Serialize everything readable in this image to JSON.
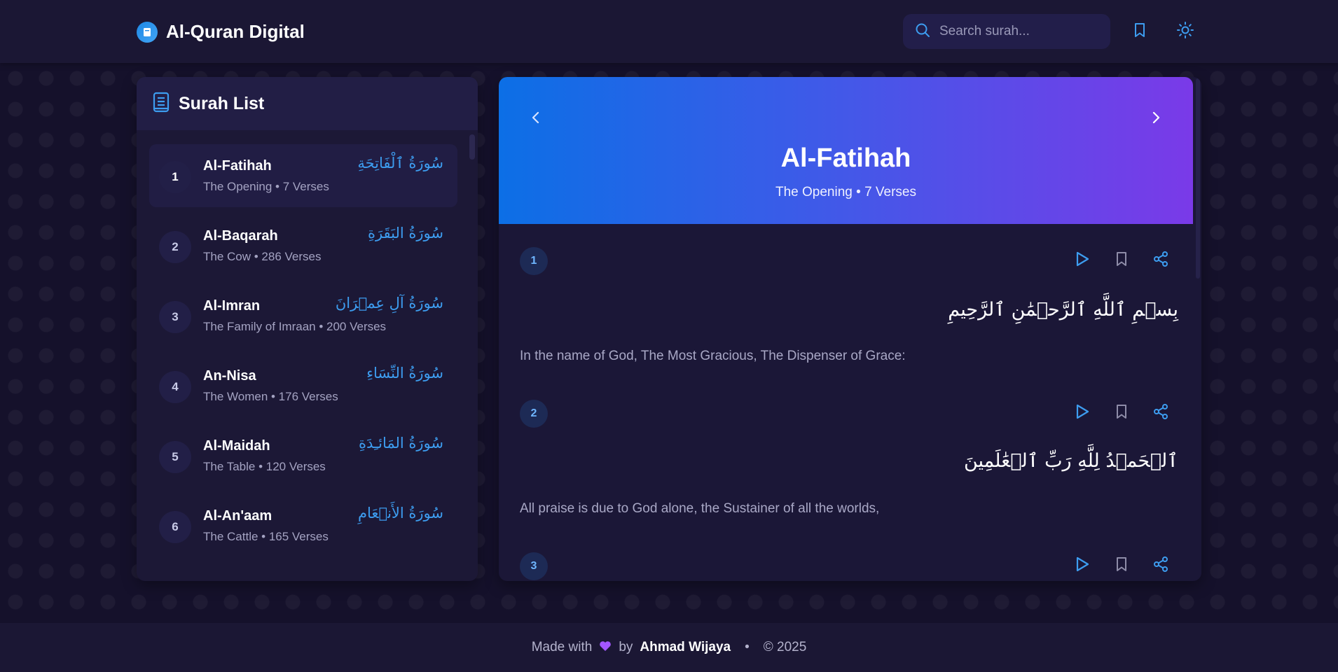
{
  "header": {
    "title": "Al-Quran Digital",
    "search_placeholder": "Search surah..."
  },
  "sidebar": {
    "title": "Surah List",
    "items": [
      {
        "number": "1",
        "name": "Al-Fatihah",
        "meta": "The Opening • 7 Verses",
        "arabic": "سُورَةُ ٱلْفَاتِحَةِ"
      },
      {
        "number": "2",
        "name": "Al-Baqarah",
        "meta": "The Cow • 286 Verses",
        "arabic": "سُورَةُ البَقَرَةِ"
      },
      {
        "number": "3",
        "name": "Al-Imran",
        "meta": "The Family of Imraan • 200 Verses",
        "arabic": "سُورَةُ آلِ عِمۡرَانَ"
      },
      {
        "number": "4",
        "name": "An-Nisa",
        "meta": "The Women • 176 Verses",
        "arabic": "سُورَةُ النِّسَاءِ"
      },
      {
        "number": "5",
        "name": "Al-Maidah",
        "meta": "The Table • 120 Verses",
        "arabic": "سُورَةُ المَائـِدَةِ"
      },
      {
        "number": "6",
        "name": "Al-An'aam",
        "meta": "The Cattle • 165 Verses",
        "arabic": "سُورَةُ الأَنۡعَامِ"
      }
    ]
  },
  "main": {
    "title": "Al-Fatihah",
    "subtitle": "The Opening • 7 Verses",
    "verses": [
      {
        "number": "1",
        "arabic": "بِسۡمِ ٱللَّهِ ٱلرَّحۡمَٰنِ ٱلرَّحِيمِ",
        "translation": "In the name of God, The Most Gracious, The Dispenser of Grace:"
      },
      {
        "number": "2",
        "arabic": "ٱلۡحَمۡدُ لِلَّهِ رَبِّ ٱلۡعَٰلَمِينَ",
        "translation": "All praise is due to God alone, the Sustainer of all the worlds,"
      },
      {
        "number": "3",
        "arabic": "",
        "translation": ""
      }
    ]
  },
  "footer": {
    "made_with": "Made with",
    "by": "by",
    "author": "Ahmad Wijaya",
    "dot": "•",
    "copyright": "© 2025"
  },
  "colors": {
    "accent": "#3d9df0",
    "background": "#15112b",
    "hero_start": "#0c6fe6",
    "hero_end": "#7a3ae8"
  },
  "icons": {
    "brand": "quran-book-icon",
    "search": "search-icon",
    "bookmark": "bookmark-icon",
    "theme": "sun-icon",
    "list": "list-book-icon",
    "prev": "chevron-left-icon",
    "next": "chevron-right-icon",
    "play": "play-icon",
    "share": "share-icon",
    "heart": "heart-icon"
  }
}
